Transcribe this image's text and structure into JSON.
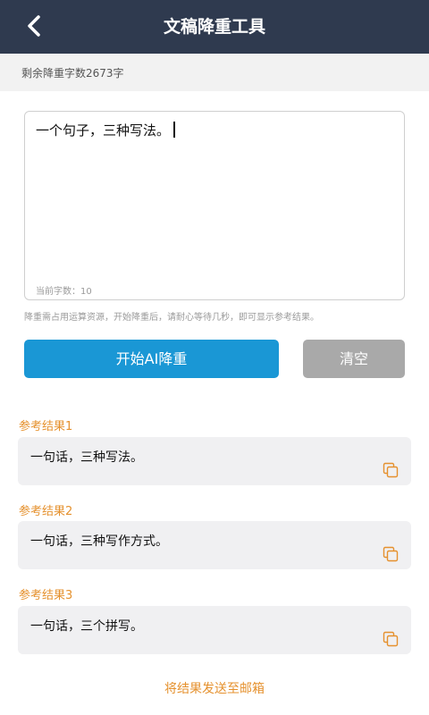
{
  "header": {
    "title": "文稿降重工具",
    "back_icon": "chevron-left-icon"
  },
  "quota": {
    "text": "剩余降重字数2673字"
  },
  "editor": {
    "value": "一个句子，三种写法。",
    "count_label": "当前字数：10"
  },
  "notice": "降重需占用运算资源，开始降重后，请耐心等待几秒，即可显示参考结果。",
  "buttons": {
    "start": "开始AI降重",
    "clear": "清空"
  },
  "results": [
    {
      "label": "参考结果1",
      "text": "一句话，三种写法。"
    },
    {
      "label": "参考结果2",
      "text": "一句话，三种写作方式。"
    },
    {
      "label": "参考结果3",
      "text": "一句话，三个拼写。"
    }
  ],
  "email_link": "将结果发送至邮箱",
  "colors": {
    "header": "#2f3a4f",
    "primary": "#1a97d5",
    "accent": "#e5912e",
    "clear": "#a9a9a9"
  }
}
